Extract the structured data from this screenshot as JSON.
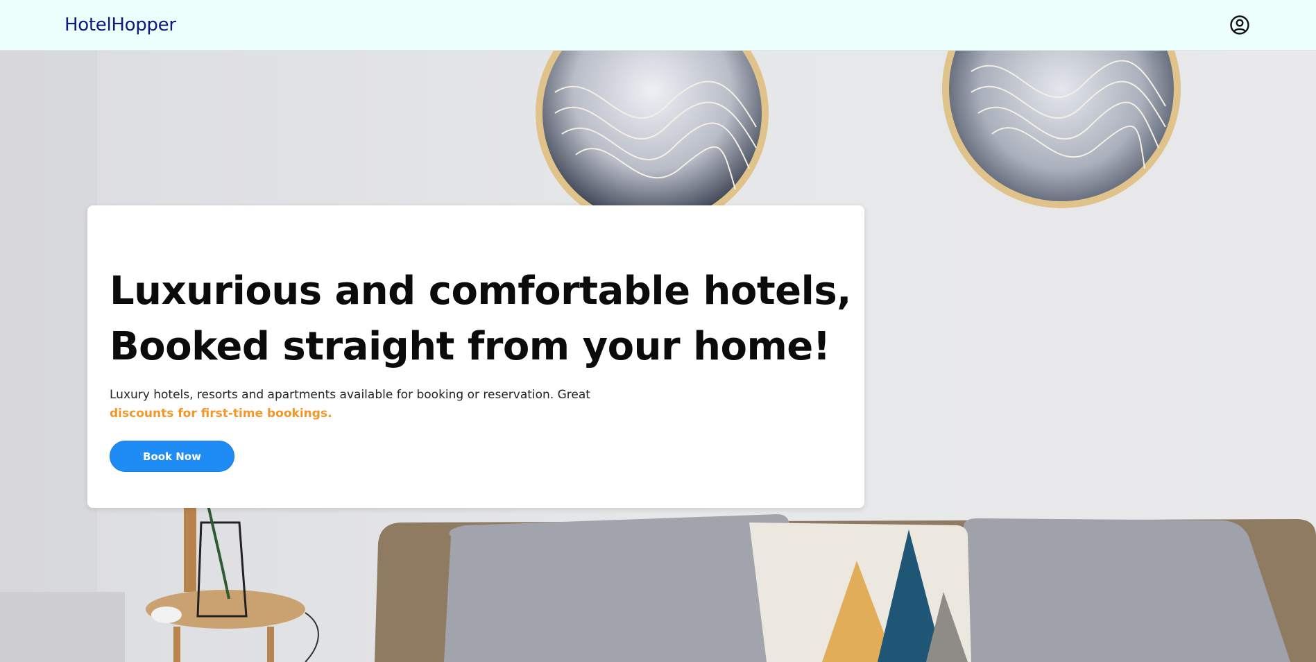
{
  "nav": {
    "brand": "HotelHopper",
    "account_icon": "user-circle-icon"
  },
  "hero": {
    "headline_line1": "Luxurious and comfortable hotels,",
    "headline_line2": "Booked straight from your home!",
    "description": "Luxury hotels, resorts and apartments available for booking or reservation. Great",
    "highlight": "discounts for first-time bookings.",
    "cta_label": "Book Now"
  },
  "colors": {
    "nav_background": "#ecfffd",
    "brand": "#0f1a7a",
    "accent_orange": "#f2962a",
    "button_blue": "#1f8cf5"
  }
}
